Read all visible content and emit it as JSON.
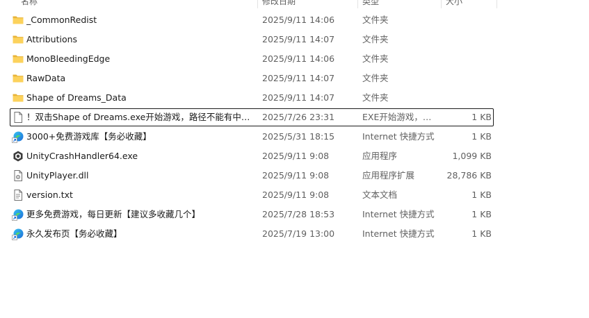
{
  "columns": {
    "name": "名称",
    "date": "修改日期",
    "type": "类型",
    "size": "大小"
  },
  "files": [
    {
      "icon": "folder-icon",
      "name": "_CommonRedist",
      "date": "2025/9/11 14:06",
      "type": "文件夹",
      "size": ""
    },
    {
      "icon": "folder-icon",
      "name": "Attributions",
      "date": "2025/9/11 14:07",
      "type": "文件夹",
      "size": ""
    },
    {
      "icon": "folder-icon",
      "name": "MonoBleedingEdge",
      "date": "2025/9/11 14:06",
      "type": "文件夹",
      "size": ""
    },
    {
      "icon": "folder-icon",
      "name": "RawData",
      "date": "2025/9/11 14:07",
      "type": "文件夹",
      "size": ""
    },
    {
      "icon": "folder-icon",
      "name": "Shape of Dreams_Data",
      "date": "2025/9/11 14:07",
      "type": "文件夹",
      "size": ""
    },
    {
      "icon": "document-icon",
      "name": "！双击Shape of Dreams.exe开始游戏，路径不能有中文！",
      "date": "2025/7/26 23:31",
      "type": "EXE开始游戏，路...",
      "size": "1 KB",
      "focused": true
    },
    {
      "icon": "internet-shortcut-icon",
      "name": "3000+免费游戏库【务必收藏】",
      "date": "2025/5/31 18:15",
      "type": "Internet 快捷方式",
      "size": "1 KB"
    },
    {
      "icon": "unity-app-icon",
      "name": "UnityCrashHandler64.exe",
      "date": "2025/9/11 9:08",
      "type": "应用程序",
      "size": "1,099 KB"
    },
    {
      "icon": "dll-file-icon",
      "name": "UnityPlayer.dll",
      "date": "2025/9/11 9:08",
      "type": "应用程序扩展",
      "size": "28,786 KB"
    },
    {
      "icon": "text-file-icon",
      "name": "version.txt",
      "date": "2025/9/11 9:08",
      "type": "文本文档",
      "size": "1 KB"
    },
    {
      "icon": "internet-shortcut-icon",
      "name": "更多免费游戏，每日更新【建议多收藏几个】",
      "date": "2025/7/28 18:53",
      "type": "Internet 快捷方式",
      "size": "1 KB"
    },
    {
      "icon": "internet-shortcut-icon",
      "name": "永久发布页【务必收藏】",
      "date": "2025/7/19 13:00",
      "type": "Internet 快捷方式",
      "size": "1 KB"
    }
  ]
}
